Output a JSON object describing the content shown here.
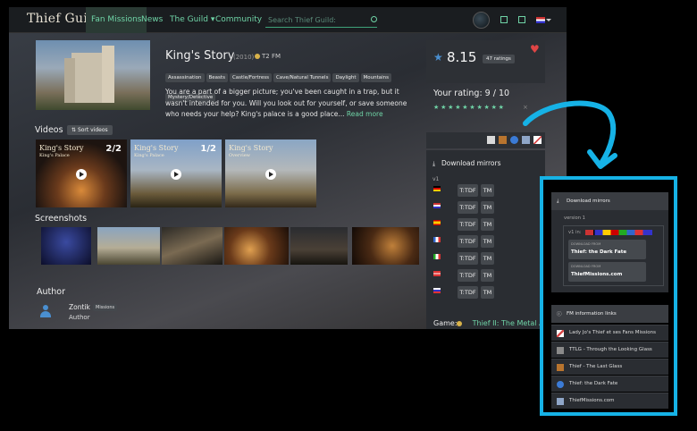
{
  "nav": {
    "logo": "Thief Guild",
    "items": [
      {
        "label": "Fan Missions",
        "active": true
      },
      {
        "label": "News"
      },
      {
        "label": "The Guild ▾"
      },
      {
        "label": "Community"
      }
    ],
    "search_placeholder": "Search Thief Guild:"
  },
  "mission": {
    "title": "King's Story",
    "year": "(2010)",
    "game_short": "T2 FM",
    "tags": [
      "Assassination",
      "Beasts",
      "Castle/Fortress",
      "Cave/Natural Tunnels",
      "Daylight",
      "Mountains",
      "Mystery/Detective"
    ],
    "description": "You are a part of a bigger picture; you've been caught in a trap, but it wasn't intended for you. Will you look out for yourself, or save someone who needs your help? King's palace is a good place...",
    "read_more": "Read more"
  },
  "videos": {
    "heading": "Videos",
    "sort_label": "Sort videos",
    "items": [
      {
        "title": "King's Story",
        "subtitle": "King's Palace",
        "num": "2/2"
      },
      {
        "title": "King's Story",
        "subtitle": "King's Palace",
        "num": "1/2"
      },
      {
        "title": "King's Story",
        "subtitle": "Overview",
        "num": ""
      }
    ]
  },
  "screenshots": {
    "heading": "Screenshots"
  },
  "author": {
    "heading": "Author",
    "name": "Zontik",
    "badge": "Missions",
    "role": "Author"
  },
  "rating": {
    "score": "8.15",
    "count_badge": "47 ratings",
    "your_rating": "Your rating: 9 / 10",
    "stars": "★★★★★★★★★★",
    "clear": "×"
  },
  "download": {
    "title": "Download mirrors",
    "version": "v1",
    "mirror_button_tdf": "T:TDF",
    "mirror_button_tm": "TM"
  },
  "game": {
    "label": "Game:",
    "value": "Thief II: The Metal Age"
  },
  "inset": {
    "download_title": "Download mirrors",
    "version_label": "version 1",
    "version_short": "v1 in:",
    "mirrors": [
      {
        "kicker": "DOWNLOAD FROM",
        "name": "Thief: the Dark Fate"
      },
      {
        "kicker": "DOWNLOAD FROM",
        "name": "ThiefMissions.com"
      }
    ],
    "info_title": "FM information links",
    "info_links": [
      {
        "label": "Lady Jo's Thief et ses Fans Missions",
        "icon": "slash-icon",
        "color": "#d94a4a"
      },
      {
        "label": "TTLG - Through the Looking Glass",
        "icon": "ttlg-icon",
        "color": "#8a8a8a"
      },
      {
        "label": "Thief - The Last Glass",
        "icon": "tlg-icon",
        "color": "#b8742e"
      },
      {
        "label": "Thief: the Dark Fate",
        "icon": "tdf-icon",
        "color": "#3b7bd6"
      },
      {
        "label": "ThiefMissions.com",
        "icon": "tm-icon",
        "color": "#8fa6c8"
      }
    ]
  },
  "colors": {
    "accent": "#6fd3a6",
    "inset_border": "#16b2e6",
    "heart": "#e04545"
  }
}
